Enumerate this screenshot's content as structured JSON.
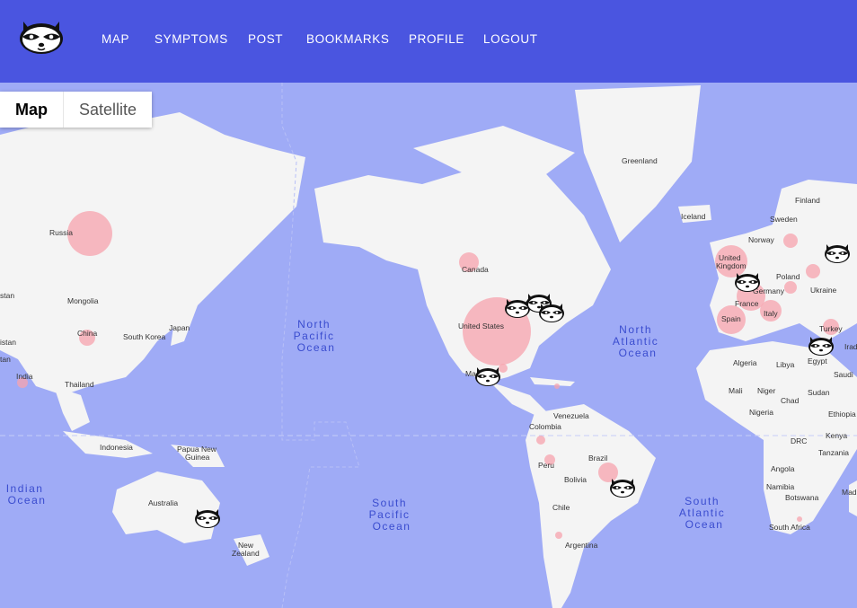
{
  "nav": {
    "logo": "raccoon-logo",
    "items": [
      "MAP",
      "SYMPTOMS",
      "POST",
      "BOOKMARKS",
      "PROFILE",
      "LOGOUT"
    ]
  },
  "map_type": {
    "map": "Map",
    "satellite": "Satellite"
  },
  "places": {
    "greenland": "Greenland",
    "iceland": "Iceland",
    "finland": "Finland",
    "sweden": "Sweden",
    "norway": "Norway",
    "russia": "Russia",
    "mongolia": "Mongolia",
    "china": "China",
    "south_korea": "South Korea",
    "japan": "Japan",
    "india": "India",
    "thailand": "Thailand",
    "indonesia": "Indonesia",
    "papua": "Papua New Guinea",
    "australia": "Australia",
    "new_zealand": "New Zealand",
    "canada": "Canada",
    "united_states": "United States",
    "mexico": "Mexico",
    "venezuela": "Venezuela",
    "colombia": "Colombia",
    "peru": "Peru",
    "brazil": "Brazil",
    "bolivia": "Bolivia",
    "chile": "Chile",
    "argentina": "Argentina",
    "uk": "United Kingdom",
    "poland": "Poland",
    "germany": "Germany",
    "ukraine": "Ukraine",
    "france": "France",
    "italy": "Italy",
    "spain": "Spain",
    "turkey": "Turkey",
    "algeria": "Algeria",
    "libya": "Libya",
    "egypt": "Egypt",
    "mali": "Mali",
    "niger": "Niger",
    "chad": "Chad",
    "sudan": "Sudan",
    "nigeria": "Nigeria",
    "ethiopia": "Ethiopia",
    "drc": "DRC",
    "kenya": "Kenya",
    "tanzania": "Tanzania",
    "angola": "Angola",
    "namibia": "Namibia",
    "botswana": "Botswana",
    "south_africa": "South Africa",
    "stan1": "stan",
    "stan2": "istan",
    "stan3": "tan",
    "irad": "Irad",
    "saudi": "Saudi",
    "mad": "Mad"
  },
  "oceans": {
    "north_pacific": [
      "North",
      "Pacific",
      "Ocean"
    ],
    "north_atlantic": [
      "North",
      "Atlantic",
      "Ocean"
    ],
    "south_pacific": [
      "South",
      "Pacific",
      "Ocean"
    ],
    "south_atlantic": [
      "South",
      "Atlantic",
      "Ocean"
    ],
    "indian": [
      "Indian",
      "Ocean"
    ]
  },
  "colors": {
    "topbar": "#4a55e0",
    "water": "#9fabf6",
    "land": "#f4f4f4",
    "heat": "#f7a3ad"
  },
  "markers": [
    "raccoon-marker",
    "raccoon-marker",
    "raccoon-marker",
    "raccoon-marker",
    "raccoon-marker",
    "raccoon-marker",
    "raccoon-marker",
    "raccoon-marker",
    "raccoon-marker"
  ]
}
